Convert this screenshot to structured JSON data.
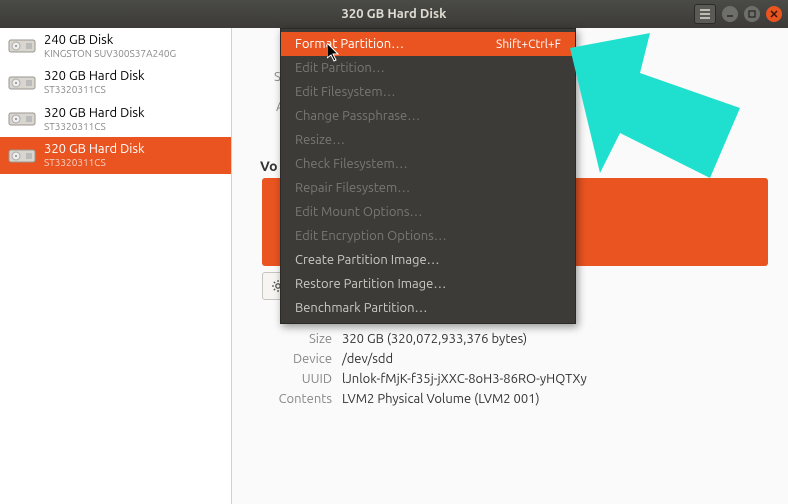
{
  "titlebar": {
    "title": "320 GB Hard Disk"
  },
  "sidebar": {
    "disks": [
      {
        "name": "240 GB Disk",
        "sub": "KINGSTON SUV300S37A240G"
      },
      {
        "name": "320 GB Hard Disk",
        "sub": "ST3320311CS"
      },
      {
        "name": "320 GB Hard Disk",
        "sub": "ST3320311CS"
      },
      {
        "name": "320 GB Hard Disk",
        "sub": "ST3320311CS"
      }
    ]
  },
  "content": {
    "truncated_s": "Se",
    "truncated_a": "A",
    "volumes_label": "Vo"
  },
  "menu": {
    "format": {
      "label": "Format Partition…",
      "accel": "Shift+Ctrl+F"
    },
    "edit_partition": "Edit Partition…",
    "edit_filesystem": "Edit Filesystem…",
    "change_passphrase": "Change Passphrase…",
    "resize": "Resize…",
    "check_fs": "Check Filesystem…",
    "repair_fs": "Repair Filesystem…",
    "edit_mount": "Edit Mount Options…",
    "edit_encryption": "Edit Encryption Options…",
    "create_image": "Create Partition Image…",
    "restore_image": "Restore Partition Image…",
    "benchmark": "Benchmark Partition…"
  },
  "details": {
    "size_key": "Size",
    "size_val": "320 GB (320,072,933,376 bytes)",
    "device_key": "Device",
    "device_val": "/dev/sdd",
    "uuid_key": "UUID",
    "uuid_val": "lJnlok-fMjK-f35j-jXXC-8oH3-86RO-yHQTXy",
    "contents_key": "Contents",
    "contents_val": "LVM2 Physical Volume (LVM2 001)"
  }
}
